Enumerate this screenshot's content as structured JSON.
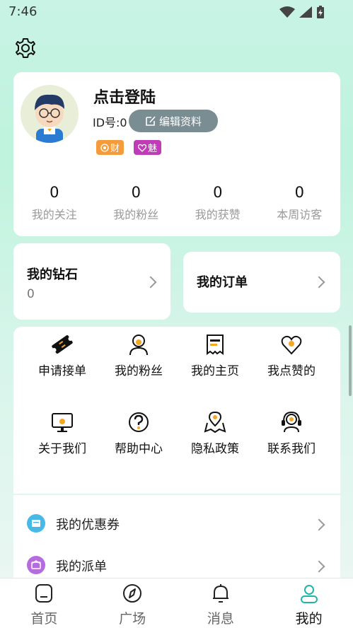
{
  "status": {
    "time": "7:46"
  },
  "profile": {
    "name": "点击登陆",
    "id_text": "ID号:0",
    "edit_label": "编辑资料",
    "badges": {
      "wealth": "财",
      "charm": "魅"
    },
    "stats": [
      {
        "value": "0",
        "label": "我的关注"
      },
      {
        "value": "0",
        "label": "我的粉丝"
      },
      {
        "value": "0",
        "label": "我的获赞"
      },
      {
        "value": "0",
        "label": "本周访客"
      }
    ]
  },
  "diamond": {
    "title": "我的钻石",
    "value": "0"
  },
  "order": {
    "title": "我的订单"
  },
  "grid": [
    {
      "label": "申请接单",
      "icon": "ticket-icon"
    },
    {
      "label": "我的粉丝",
      "icon": "person-icon"
    },
    {
      "label": "我的主页",
      "icon": "receipt-icon"
    },
    {
      "label": "我点赞的",
      "icon": "heart-icon"
    },
    {
      "label": "关于我们",
      "icon": "monitor-icon"
    },
    {
      "label": "帮助中心",
      "icon": "question-icon"
    },
    {
      "label": "隐私政策",
      "icon": "map-pin-icon"
    },
    {
      "label": "联系我们",
      "icon": "headset-icon"
    }
  ],
  "list": [
    {
      "label": "我的优惠券",
      "color": "#46b9e8"
    },
    {
      "label": "我的派单",
      "color": "#b66be0"
    }
  ],
  "tabs": [
    {
      "label": "首页",
      "icon": "home-icon"
    },
    {
      "label": "广场",
      "icon": "compass-icon"
    },
    {
      "label": "消息",
      "icon": "bell-icon"
    },
    {
      "label": "我的",
      "icon": "user-icon",
      "active": true
    }
  ],
  "colors": {
    "accent": "#1fb6a8",
    "icon_highlight": "#f5a623",
    "edit_button": "#7a8d93"
  }
}
